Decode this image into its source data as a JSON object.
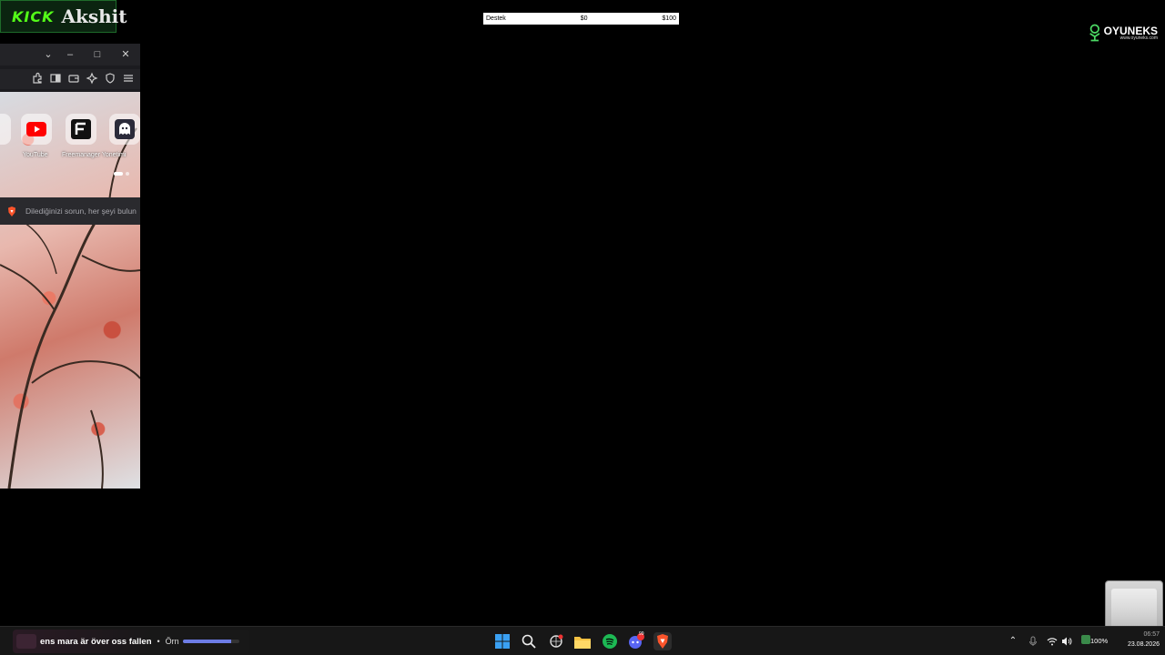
{
  "kick_overlay": {
    "brand": "KICK",
    "channel": "Akshit"
  },
  "donation_bar": {
    "label": "Destek",
    "current": "$0",
    "goal": "$100"
  },
  "sponsor": {
    "name": "OYUNEKS",
    "url": "www.oyuneks.com"
  },
  "browser": {
    "shortcuts": [
      {
        "label": "YouTube",
        "icon": "youtube-icon"
      },
      {
        "label": "Freemanager Yonetimi",
        "icon": "f-letter-icon"
      },
      {
        "label": "Fri",
        "icon": "ghost-icon"
      }
    ],
    "search_placeholder": "Dilediğinizi sorun, her şeyi bulun"
  },
  "taskbar": {
    "media": {
      "title": "ens mara är över oss fallen",
      "artist": "Örn",
      "progress": 0.85,
      "separator": "•"
    },
    "apps": [
      "windows-start-icon",
      "search-icon",
      "chatgpt-icon",
      "file-explorer-icon",
      "spotify-icon",
      "discord-icon",
      "brave-icon"
    ],
    "discord_badge": "99",
    "battery": "100%",
    "time": "06:57",
    "date": "23.08.2026"
  },
  "colors": {
    "kick_green": "#53fc18",
    "spotify": "#1db954",
    "brave": "#fb542b",
    "discord": "#5865f2"
  }
}
